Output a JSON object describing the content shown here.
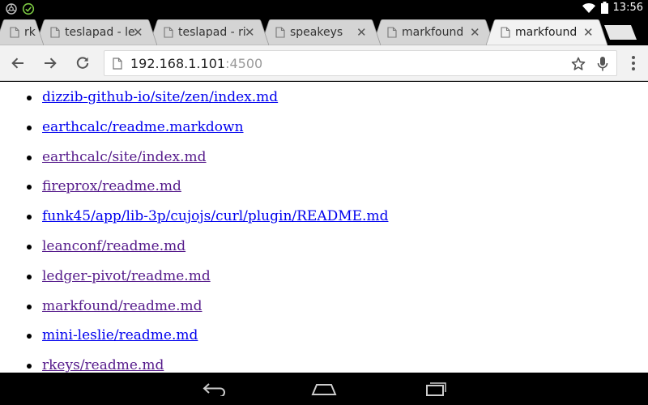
{
  "status_bar": {
    "time": "13:56",
    "left_icons": [
      "chrome-sync-icon",
      "check-circle-icon"
    ],
    "right_icons": [
      "wifi-icon",
      "battery-icon"
    ]
  },
  "tabs": [
    {
      "title": "rk",
      "active": false
    },
    {
      "title": "teslapad - le",
      "active": false
    },
    {
      "title": "teslapad - ri",
      "active": false
    },
    {
      "title": "speakeys",
      "active": false
    },
    {
      "title": "markfound",
      "active": false
    },
    {
      "title": "markfound",
      "active": true
    }
  ],
  "toolbar": {
    "url_host": "192.168.1.101",
    "url_port": ":4500"
  },
  "links": [
    {
      "text": "dizzib-github-io/site/zen/index.md",
      "visited": false
    },
    {
      "text": "earthcalc/readme.markdown",
      "visited": false
    },
    {
      "text": "earthcalc/site/index.md",
      "visited": true
    },
    {
      "text": "fireprox/readme.md",
      "visited": true
    },
    {
      "text": "funk45/app/lib-3p/cujojs/curl/plugin/README.md",
      "visited": false
    },
    {
      "text": "leanconf/readme.md",
      "visited": true
    },
    {
      "text": "ledger-pivot/readme.md",
      "visited": true
    },
    {
      "text": "markfound/readme.md",
      "visited": true
    },
    {
      "text": "mini-leslie/readme.md",
      "visited": false
    },
    {
      "text": "rkeys/readme.md",
      "visited": true
    }
  ],
  "colors": {
    "link": "#0000ee",
    "visited": "#551a8b",
    "toolbar_bg": "#f2f2f2",
    "tab_active": "#f2f2f2",
    "tab_inactive": "#d4d4d4"
  }
}
